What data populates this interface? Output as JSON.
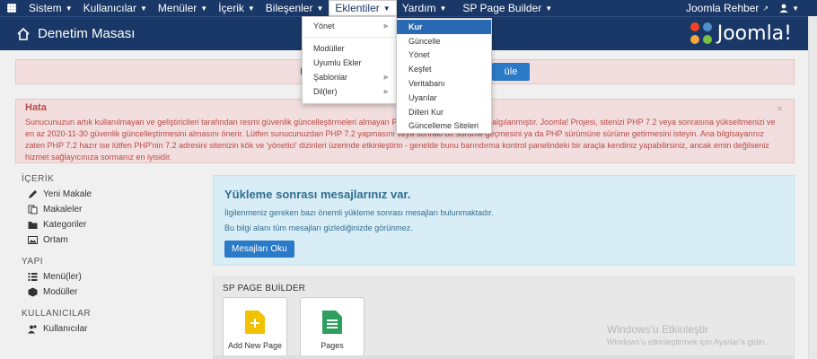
{
  "navbar": {
    "items": [
      {
        "label": "Sistem"
      },
      {
        "label": "Kullanıcılar"
      },
      {
        "label": "Menüler"
      },
      {
        "label": "İçerik"
      },
      {
        "label": "Bileşenler"
      },
      {
        "label": "Eklentiler"
      },
      {
        "label": "Yardım"
      },
      {
        "label": "SP Page Builder"
      }
    ],
    "site_link": "Joomla Rehber"
  },
  "header": {
    "title": "Denetim Masası",
    "brand": "Joomla!"
  },
  "alert_top": {
    "fragment": "E",
    "button_fragment": "üle"
  },
  "alert_error": {
    "heading": "Hata",
    "body": "Sunucunuzun artık kullanılmayan ve geliştiricileri tarafından resmi güvenlik güncelleştirmeleri almayan PHP 5 sürümünü kullandığı algılanmıştır. Joomla! Projesi, sitenizi PHP 7.2 veya sonrasına yükseltmenizi ve en az 2020-11-30 güvenlik güncelleştirmesini almasını önerir. Lütfen sunucunuzdan PHP 7.2 yapmasını veya sonraki bir sürüme geçmesini ya da PHP sürümüne sürüme getirmesini isteyin. Ana bilgisayarınız zaten PHP 7.2 hazır ise lütfen PHP'nin 7.2 adresini sitenizin kök ve 'yönetici' dizinleri üzerinde etkinleştirin - genelde bunu barındırma kontrol panelindeki bir araçla kendiniz yapabilirsiniz, ancak emin değilseniz hizmet sağlayıcınıza sormanız en iyisidir.",
    "close": "×"
  },
  "sidebar": {
    "sections": [
      {
        "heading": "İÇERİK",
        "items": [
          "Yeni Makale",
          "Makaleler",
          "Kategoriler",
          "Ortam"
        ]
      },
      {
        "heading": "YAPI",
        "items": [
          "Menü(ler)",
          "Modüller"
        ]
      },
      {
        "heading": "KULLANICILAR",
        "items": [
          "Kullanıcılar"
        ]
      }
    ]
  },
  "post_install": {
    "title": "Yükleme sonrası mesajlarınız var.",
    "line1": "İlgilenmeniz gereken bazı önemli yükleme sonrası mesajları bulunmaktadır.",
    "line2": "Bu bilgi alanı tüm mesajları gizlediğinizde görünmez.",
    "button": "Mesajları Oku"
  },
  "sp_builder": {
    "heading": "SP PAGE BUİLDER",
    "cards": [
      {
        "label": "Add New Page",
        "color": "#f2c200"
      },
      {
        "label": "Pages",
        "color": "#2e9e5e"
      }
    ]
  },
  "dropdown_main": {
    "items": [
      "Yönet",
      "Modüller",
      "Uyumlu Ekler",
      "Şablonlar",
      "Dil(ler)"
    ]
  },
  "dropdown_sub": {
    "items": [
      "Kur",
      "Güncelle",
      "Yönet",
      "Keşfet",
      "Veritabanı",
      "Uyarılar",
      "Dilleri Kur",
      "Güncelleme Siteleri"
    ]
  },
  "watermark": {
    "line1": "Windows'u Etkinleştir",
    "line2": "Windows'u etkinleştirmek için Ayarlar'a gidin."
  },
  "colors": {
    "navbar_bg": "#1a3867",
    "alert_bg": "#f2dede",
    "info_bg": "#d9edf7",
    "accent": "#2a7ac7"
  }
}
